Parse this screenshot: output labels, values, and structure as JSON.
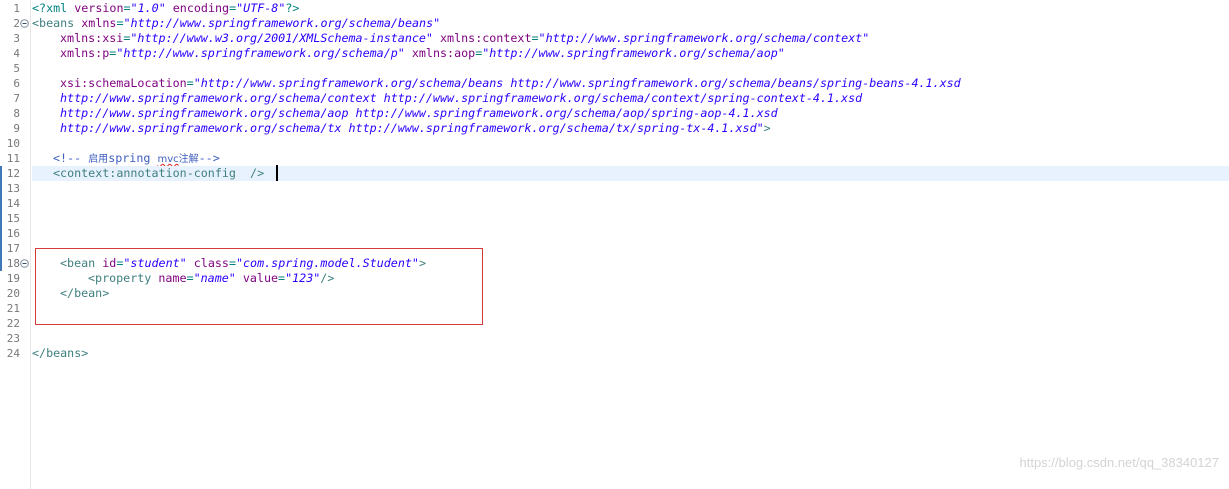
{
  "editor": {
    "line_numbers": [
      "1",
      "2",
      "3",
      "4",
      "5",
      "6",
      "7",
      "8",
      "9",
      "10",
      "11",
      "12",
      "13",
      "14",
      "15",
      "16",
      "17",
      "18",
      "19",
      "20",
      "21",
      "22",
      "23",
      "24"
    ],
    "fold_icons": [
      "minus-fold-icon",
      "minus-fold-icon"
    ],
    "lines": {
      "l1": [
        "<?xml ",
        "version",
        "=",
        "\"1.0\"",
        " encoding",
        "=",
        "\"UTF-8\"",
        "?>"
      ],
      "l2": [
        "<beans ",
        "xmlns",
        "=",
        "\"http://www.springframework.org/schema/beans\""
      ],
      "l3": [
        "xmlns:xsi",
        "=",
        "\"http://www.w3.org/2001/XMLSchema-instance\"",
        " xmlns:context",
        "=",
        "\"http://www.springframework.org/schema/context\""
      ],
      "l4": [
        "xmlns:p",
        "=",
        "\"http://www.springframework.org/schema/p\"",
        " xmlns:aop",
        "=",
        "\"http://www.springframework.org/schema/aop\""
      ],
      "l6": [
        "xsi:schemaLocation",
        "=",
        "\"http://www.springframework.org/schema/beans http://www.springframework.org/schema/beans/spring-beans-4.1.xsd"
      ],
      "l7": "http://www.springframework.org/schema/context http://www.springframework.org/schema/context/spring-context-4.1.xsd",
      "l8": "http://www.springframework.org/schema/aop http://www.springframework.org/schema/aop/spring-aop-4.1.xsd",
      "l9": [
        "http://www.springframework.org/schema/tx http://www.springframework.org/schema/tx/spring-tx-4.1.xsd\"",
        ">"
      ],
      "l11": [
        "<!-- ",
        "启用",
        "spring ",
        "mvc",
        "注解",
        "-->"
      ],
      "l12": [
        "<context:annotation-config",
        "  />"
      ],
      "l18": [
        "<bean ",
        "id",
        "=",
        "\"student\"",
        " class",
        "=",
        "\"com.spring.model.Student\"",
        ">"
      ],
      "l19": [
        "<property ",
        "name",
        "=",
        "\"name\"",
        " value",
        "=",
        "\"123\"",
        "/>"
      ],
      "l20": "</bean>",
      "l24": "</beans>"
    }
  },
  "colors": {
    "tag": "#3f7f7f",
    "attribute": "#7f007f",
    "value": "#2a00ff",
    "comment": "#3f5fbf",
    "highlight": "#d33a3a",
    "current_line": "#e8f2fe"
  },
  "watermark": "https://blog.csdn.net/qq_38340127"
}
